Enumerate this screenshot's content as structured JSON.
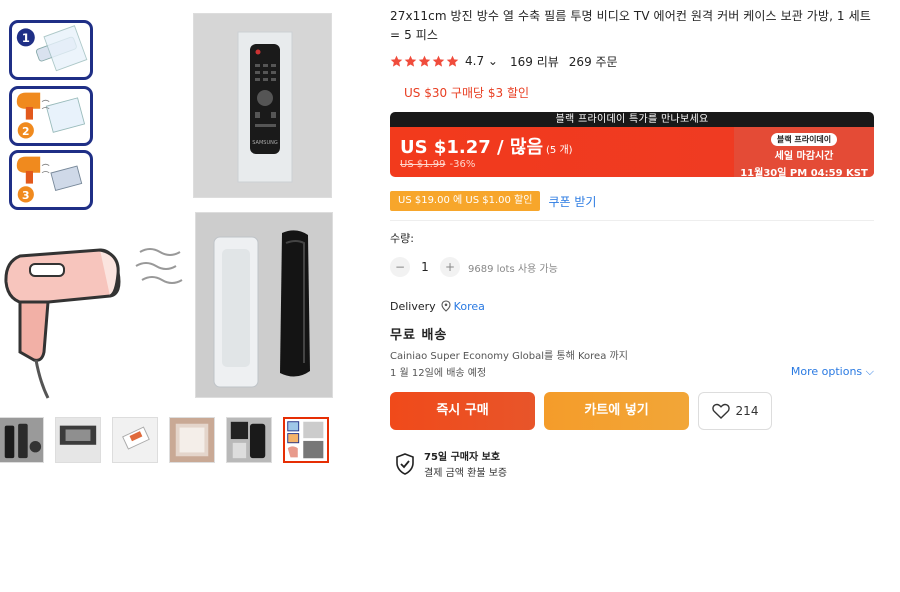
{
  "product": {
    "title": "27x11cm 방진 방수 열 수축 필름 투명 비디오 TV 에어컨 원격 커버 케이스 보관 가방, 1 세트 = 5 피스",
    "rating": "4.7",
    "rating_chevron": "⌄",
    "reviews": "169 리뷰",
    "orders": "269 주문",
    "stars_filled": 5
  },
  "promo": {
    "text": "US $30 구매당 $3 할인"
  },
  "deal": {
    "banner": "블랙 프라이데이 특가를 만나보세요",
    "price": "US $1.27 / 많음",
    "unit": "(5 개)",
    "original_price": "US $1.99",
    "discount": "-36%",
    "tag": "블랙 프라이데이",
    "ends_label": "세일 마감시간",
    "ends_time": "11월30일 PM 04:59 KST"
  },
  "coupon": {
    "chip": "US $19.00 에 US $1.00 할인",
    "link": "쿠폰 받기"
  },
  "quantity": {
    "label": "수량:",
    "minus": "−",
    "value": "1",
    "plus": "+",
    "available": "9689 lots 사용 가능"
  },
  "delivery": {
    "label": "Delivery",
    "country": "Korea",
    "free": "무료 배송",
    "via": "Cainiao Super Economy Global를 통해 Korea 까지",
    "estimate": "1 월 12일에 배송 예정",
    "more": "More options ⌵"
  },
  "actions": {
    "buy": "즉시 구매",
    "cart": "카트에 넣기",
    "wishlist_count": "214"
  },
  "protection": {
    "title": "75일 구매자 보호",
    "subtitle": "결제 금액 환불 보증"
  },
  "main_image": {
    "step_labels": [
      "1",
      "2",
      "3"
    ],
    "remote_brand": "SAMSUNG"
  },
  "thumbnails": {
    "count": 6,
    "selected": 6
  },
  "colors": {
    "accent": "#e62e04",
    "deal_red": "#f23a1c",
    "coupon_orange": "#f7a62b",
    "link_blue": "#2a7ae2",
    "star": "#f04c3c",
    "badge_border": "#1f2f86"
  },
  "icons": {
    "star": "star-icon",
    "pin": "location-pin-icon",
    "heart": "heart-icon",
    "shield": "shield-check-icon"
  }
}
